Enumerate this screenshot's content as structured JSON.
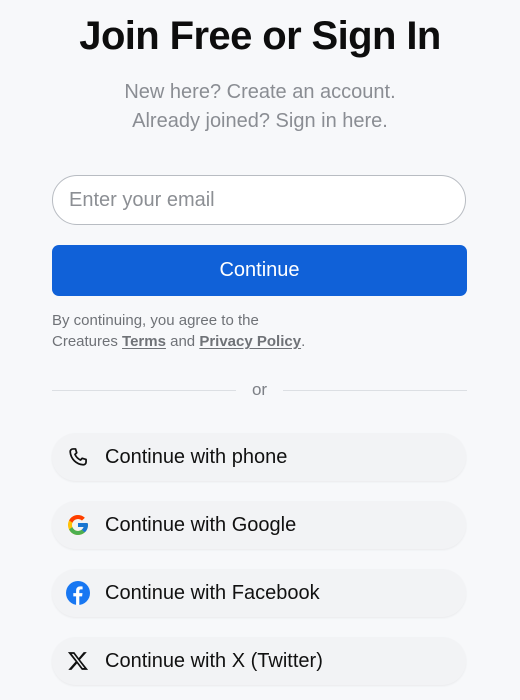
{
  "header": {
    "title": "Join Free or Sign In",
    "subtitle_line1": "New here? Create an account.",
    "subtitle_line2": "Already joined? Sign in here."
  },
  "form": {
    "email_placeholder": "Enter your email",
    "email_value": "",
    "continue_label": "Continue",
    "continue_color": "#1061d8"
  },
  "legal": {
    "prefix": "By continuing, you agree to the",
    "brand": "Creatures",
    "terms_label": "Terms",
    "and": "and",
    "privacy_label": "Privacy Policy",
    "suffix": "."
  },
  "divider": {
    "label": "or"
  },
  "social": {
    "items": [
      {
        "label": "Continue with phone",
        "icon": "phone-icon"
      },
      {
        "label": "Continue with Google",
        "icon": "google-icon"
      },
      {
        "label": "Continue with Facebook",
        "icon": "facebook-icon"
      },
      {
        "label": "Continue with X (Twitter)",
        "icon": "x-twitter-icon"
      }
    ]
  },
  "colors": {
    "google_blue": "#4285F4",
    "google_red": "#EA4335",
    "google_yellow": "#FBBC05",
    "google_green": "#34A853",
    "facebook_blue": "#1877F2"
  }
}
